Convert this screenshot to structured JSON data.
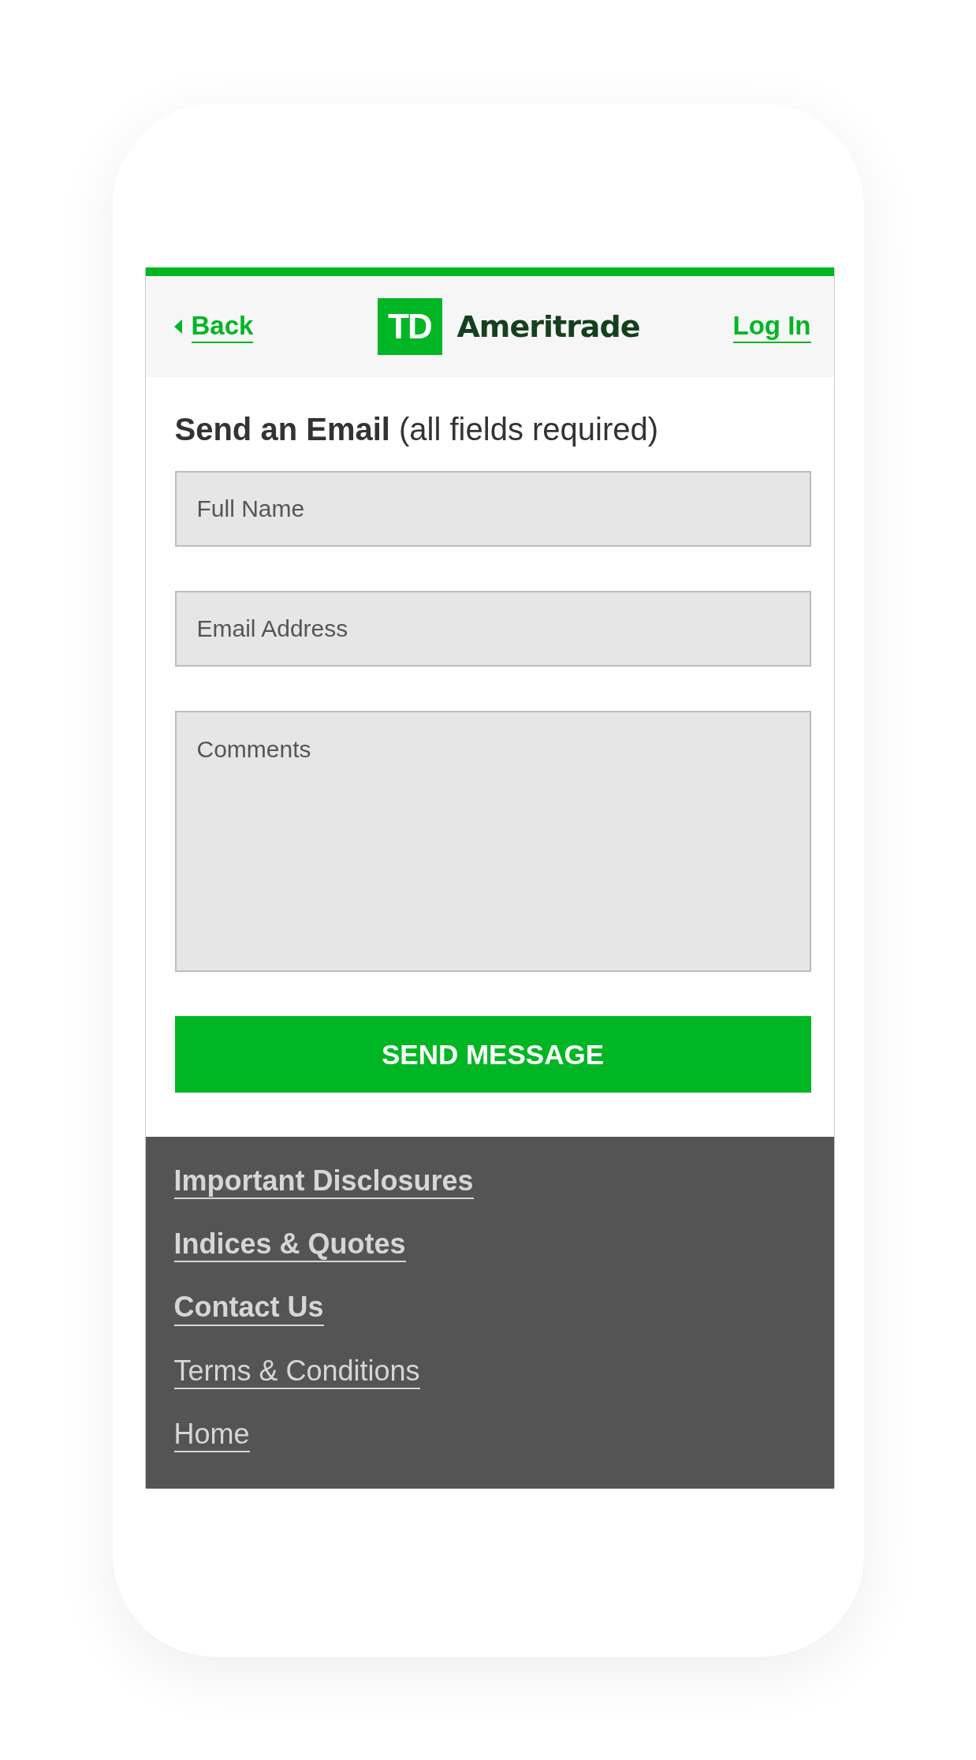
{
  "header": {
    "back": "Back",
    "logo_mark": "TD",
    "logo_name": "Ameritrade",
    "login": "Log In"
  },
  "form": {
    "title": "Send an Email",
    "note": "(all fields required)",
    "fields": [
      {
        "kind": "input",
        "placeholder": "Full Name"
      },
      {
        "kind": "input",
        "placeholder": "Email Address"
      },
      {
        "kind": "textarea",
        "placeholder": "Comments"
      }
    ],
    "submit": "SEND MESSAGE"
  },
  "footer_links": [
    {
      "label": "Important Disclosures",
      "kind": "primary"
    },
    {
      "label": "Indices & Quotes",
      "kind": "primary"
    },
    {
      "label": "Contact Us",
      "kind": "primary"
    },
    {
      "label": "Terms & Conditions",
      "kind": "secondary"
    },
    {
      "label": "Home",
      "kind": "secondary"
    }
  ]
}
